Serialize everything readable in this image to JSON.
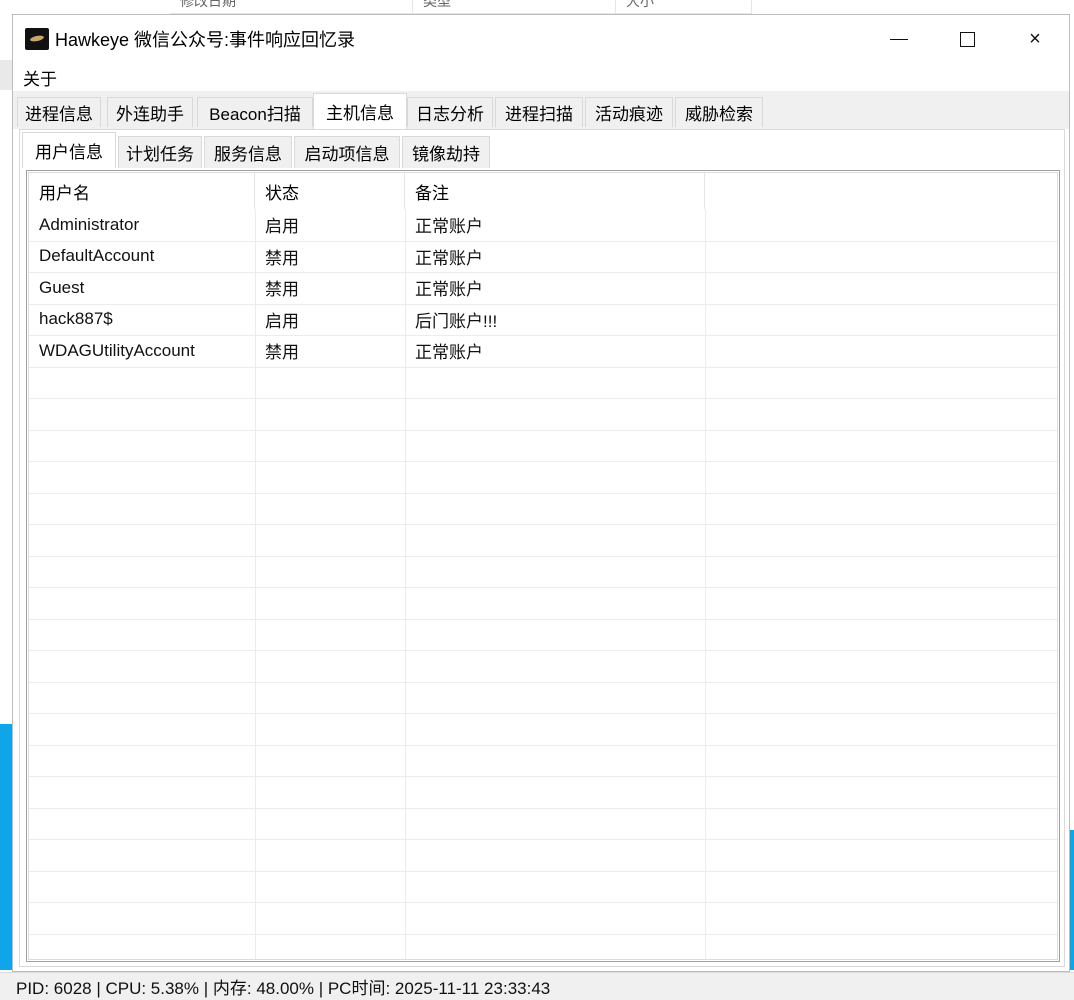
{
  "background": {
    "header_columns": [
      "修改日期",
      "类型",
      "大小"
    ]
  },
  "window": {
    "title": "Hawkeye 微信公众号:事件响应回忆录",
    "controls": {
      "minimize": "minimize",
      "maximize": "maximize",
      "close": "×"
    }
  },
  "menu": {
    "items": [
      {
        "label": "关于"
      }
    ]
  },
  "tabs": [
    {
      "label": "进程信息"
    },
    {
      "label": "外连助手"
    },
    {
      "label": "Beacon扫描"
    },
    {
      "label": "主机信息",
      "active": true
    },
    {
      "label": "日志分析"
    },
    {
      "label": "进程扫描"
    },
    {
      "label": "活动痕迹"
    },
    {
      "label": "威胁检索"
    }
  ],
  "subtabs": [
    {
      "label": "用户信息",
      "active": true
    },
    {
      "label": "计划任务"
    },
    {
      "label": "服务信息"
    },
    {
      "label": "启动项信息"
    },
    {
      "label": "镜像劫持"
    }
  ],
  "table": {
    "columns": [
      "用户名",
      "状态",
      "备注",
      ""
    ],
    "rows": [
      [
        "Administrator",
        "启用",
        "正常账户"
      ],
      [
        "DefaultAccount",
        "禁用",
        "正常账户"
      ],
      [
        "Guest",
        "禁用",
        "正常账户"
      ],
      [
        "hack887$",
        "启用",
        "后门账户!!!"
      ],
      [
        "WDAGUtilityAccount",
        "禁用",
        "正常账户"
      ]
    ]
  },
  "status": {
    "text": "PID: 6028 | CPU: 5.38% | 内存: 48.00% | PC时间: 2025-11-11 23:33:43"
  }
}
